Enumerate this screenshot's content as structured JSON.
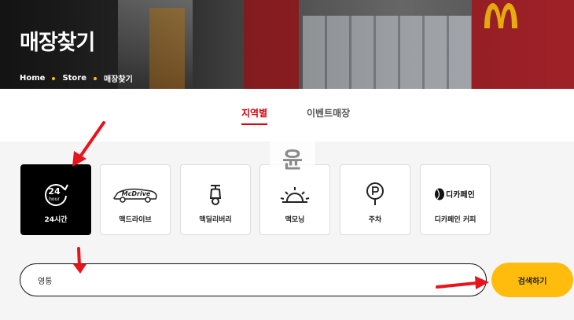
{
  "hero": {
    "title": "매장찾기",
    "breadcrumb": [
      "Home",
      "Store",
      "매장찾기"
    ]
  },
  "tabs": [
    {
      "label": "지역별",
      "active": true
    },
    {
      "label": "이벤트매장",
      "active": false
    }
  ],
  "filters": [
    {
      "label": "24시간",
      "icon": "24-hour-icon",
      "active": true
    },
    {
      "label": "맥드라이브",
      "icon": "mcdrive-car-icon",
      "active": false
    },
    {
      "label": "맥딜리버리",
      "icon": "scooter-icon",
      "active": false
    },
    {
      "label": "맥모닝",
      "icon": "sunrise-icon",
      "active": false
    },
    {
      "label": "주차",
      "icon": "parking-pin-icon",
      "active": false
    },
    {
      "label": "디카페인 커피",
      "icon": "decaf-coffee-icon",
      "active": false
    }
  ],
  "search": {
    "value": "영통",
    "button_label": "검색하기"
  },
  "icon_text": {
    "hour24_number": "24",
    "hour24_unit": "hour",
    "mcdrive": "McDrive",
    "decaf": "디카페인",
    "watermark": "윤"
  },
  "colors": {
    "accent_red": "#db0007",
    "brand_yellow": "#ffbc0d",
    "annotation_arrow": "#e8141c"
  }
}
